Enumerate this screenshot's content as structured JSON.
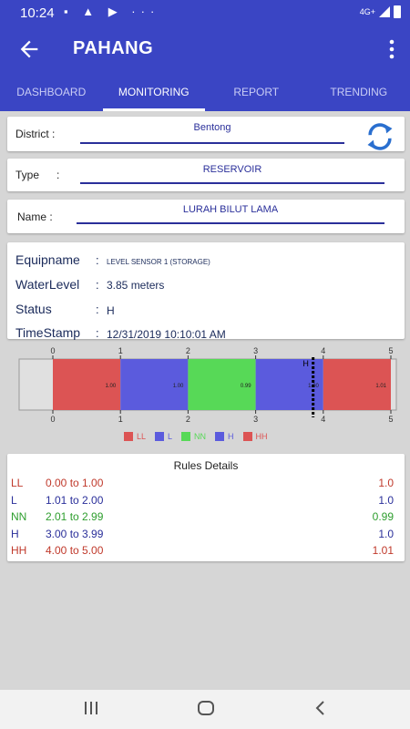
{
  "status_bar": {
    "time": "10:24",
    "network": "4G+"
  },
  "app_bar": {
    "title": "PAHANG"
  },
  "tabs": [
    {
      "label": "DASHBOARD"
    },
    {
      "label": "MONITORING",
      "active": true
    },
    {
      "label": "REPORT"
    },
    {
      "label": "TRENDING"
    }
  ],
  "filters": {
    "district_label": "District :",
    "district_value": "Bentong",
    "type_label": "Type",
    "type_colon": ":",
    "type_value": "RESERVOIR",
    "name_label": "Name :",
    "name_value": "LURAH BILUT LAMA"
  },
  "info": {
    "equipname_label": "Equipname",
    "equipname_value": "LEVEL SENSOR 1 (STORAGE)",
    "waterlevel_label": "WaterLevel",
    "waterlevel_value": "3.85 meters",
    "status_label": "Status",
    "status_value": "H",
    "timestamp_label": "TimeStamp",
    "timestamp_value": "12/31/2019 10:10:01 AM",
    "colon": ":"
  },
  "chart_data": {
    "type": "bar",
    "orientation": "horizontal-stacked",
    "xlim": [
      0,
      5
    ],
    "ticks": [
      "0",
      "1",
      "2",
      "3",
      "4",
      "5"
    ],
    "segments": [
      {
        "name": "LL",
        "start": 0,
        "end": 1,
        "label": "1.00",
        "color": "#dc5454"
      },
      {
        "name": "L",
        "start": 1,
        "end": 2,
        "label": "1.00",
        "color": "#5b5bdd"
      },
      {
        "name": "NN",
        "start": 2,
        "end": 3,
        "label": "0.99",
        "color": "#57d957"
      },
      {
        "name": "H",
        "start": 3,
        "end": 4,
        "label": "1.00",
        "color": "#5b5bdd"
      },
      {
        "name": "HH",
        "start": 4,
        "end": 5,
        "label": "1.01",
        "color": "#dc5454"
      }
    ],
    "marker": {
      "value": 3.85,
      "label": "H"
    },
    "legend": [
      "LL",
      "L",
      "NN",
      "H",
      "HH"
    ]
  },
  "rules": {
    "title": "Rules Details",
    "rows": [
      {
        "code": "LL",
        "range": "0.00 to 1.00",
        "value": "1.0",
        "color": "#c0392b"
      },
      {
        "code": "L",
        "range": "1.01 to 2.00",
        "value": "1.0",
        "color": "#2a2f9a"
      },
      {
        "code": "NN",
        "range": "2.01 to 2.99",
        "value": "0.99",
        "color": "#2e9e2e"
      },
      {
        "code": "H",
        "range": "3.00 to 3.99",
        "value": "1.0",
        "color": "#2a2f9a"
      },
      {
        "code": "HH",
        "range": "4.00 to 5.00",
        "value": "1.01",
        "color": "#c0392b"
      }
    ]
  }
}
